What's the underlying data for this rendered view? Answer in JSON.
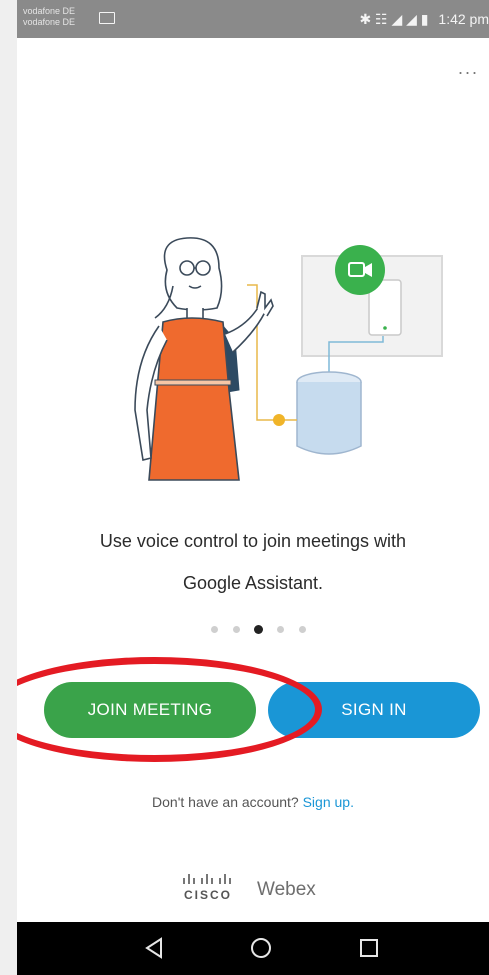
{
  "status_bar": {
    "carrier_line_1": "vodafone DE",
    "carrier_line_2": "vodafone DE",
    "icons_right": "✱ ☷ ◢ ◢ ▮",
    "time": "1:42 pm"
  },
  "menu": {
    "more_label": "..."
  },
  "illustration": {
    "person_dress_color": "#ef6a2e",
    "camera_badge_color": "#3ab14d",
    "speaker_color": "#c6dbee"
  },
  "caption": {
    "line1": "Use voice control to join meetings with",
    "line2": "Google Assistant."
  },
  "pager": {
    "count": 5,
    "active_index": 2
  },
  "buttons": {
    "join_label": "JOIN MEETING",
    "signin_label": "SIGN IN",
    "join_color": "#3aa34a",
    "signin_color": "#1a96d6"
  },
  "account": {
    "prompt": "Don't have an account?",
    "signup_link": "Sign up."
  },
  "brand": {
    "company": "CISCO",
    "product": "Webex"
  },
  "annotation": {
    "highlight_color": "#e41b23"
  }
}
